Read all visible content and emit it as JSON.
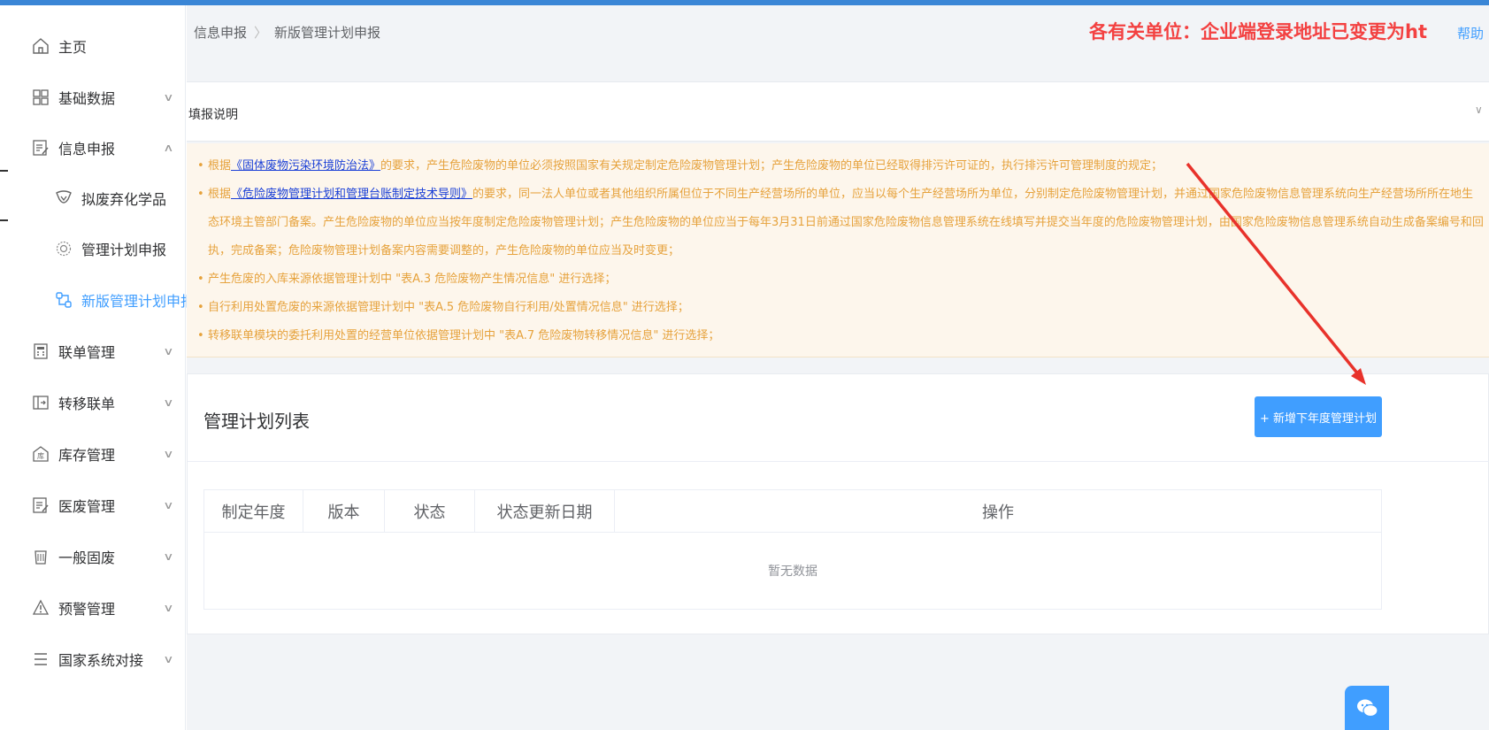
{
  "sidebar": {
    "items": [
      {
        "label": "主页",
        "icon": "home-icon",
        "has_chevron": false
      },
      {
        "label": "基础数据",
        "icon": "grid-icon",
        "has_chevron": true
      },
      {
        "label": "信息申报",
        "icon": "edit-doc-icon",
        "has_chevron": true,
        "expanded": true
      },
      {
        "label": "拟废弃化学品",
        "icon": "flask-icon",
        "sub": true
      },
      {
        "label": "管理计划申报",
        "icon": "gear-badge-icon",
        "sub": true
      },
      {
        "label": "新版管理计划申报",
        "icon": "branch-icon",
        "sub": true,
        "active": true
      },
      {
        "label": "联单管理",
        "icon": "calculator-icon",
        "has_chevron": true
      },
      {
        "label": "转移联单",
        "icon": "transfer-icon",
        "has_chevron": true
      },
      {
        "label": "库存管理",
        "icon": "warehouse-icon",
        "has_chevron": true
      },
      {
        "label": "医废管理",
        "icon": "medical-doc-icon",
        "has_chevron": true
      },
      {
        "label": "一般固废",
        "icon": "trash-icon",
        "has_chevron": true
      },
      {
        "label": "预警管理",
        "icon": "alert-icon",
        "has_chevron": true
      },
      {
        "label": "国家系统对接",
        "icon": "menu-lines-icon",
        "has_chevron": true
      }
    ]
  },
  "breadcrumb": {
    "level1": "信息申报",
    "separator": "〉",
    "level2": "新版管理计划申报"
  },
  "notice": "各有关单位：企业端登录地址已变更为ht",
  "help_link": "帮助",
  "fill_section": {
    "title": "填报说明"
  },
  "info_lines": [
    {
      "prefix": "根据",
      "link": "《固体废物污染环境防治法》",
      "text": "的要求，产生危险废物的单位必须按照国家有关规定制定危险废物管理计划；产生危险废物的单位已经取得排污许可证的，执行排污许可管理制度的规定；"
    },
    {
      "prefix": "根据",
      "link": "《危险废物管理计划和管理台账制定技术导则》",
      "text": "的要求，同一法人单位或者其他组织所属但位于不同生产经营场所的单位，应当以每个生产经营场所为单位，分别制定危险废物管理计划，并通过国家危险废物信息管理系统向生产经营场所所在地生"
    },
    {
      "prefix": "",
      "link": "",
      "text": "态环境主管部门备案。产生危险废物的单位应当按年度制定危险废物管理计划；产生危险废物的单位应当于每年3月31日前通过国家危险废物信息管理系统在线填写并提交当年度的危险废物管理计划，由国家危险废物信息管理系统自动生成备案编号和回"
    },
    {
      "prefix": "",
      "link": "",
      "text": "执，完成备案；危险废物管理计划备案内容需要调整的，产生危险废物的单位应当及时变更；"
    },
    {
      "prefix": "",
      "link": "",
      "text": "产生危废的入库来源依据管理计划中 \"表A.3 危险废物产生情况信息\" 进行选择；"
    },
    {
      "prefix": "",
      "link": "",
      "text": "自行利用处置危废的来源依据管理计划中 \"表A.5 危险废物自行利用/处置情况信息\" 进行选择；"
    },
    {
      "prefix": "",
      "link": "",
      "text": "转移联单模块的委托利用处置的经营单位依据管理计划中 \"表A.7 危险废物转移情况信息\" 进行选择；"
    }
  ],
  "plan_list": {
    "title": "管理计划列表",
    "add_button": "+ 新增下年度管理计划",
    "columns": [
      "制定年度",
      "版本",
      "状态",
      "状态更新日期",
      "操作"
    ],
    "empty_text": "暂无数据"
  },
  "colors": {
    "accent": "#409eff",
    "notice": "#f34141",
    "info_bg": "#fdf6ec",
    "info_text": "#e6a23c",
    "arrow": "#e8322b"
  }
}
